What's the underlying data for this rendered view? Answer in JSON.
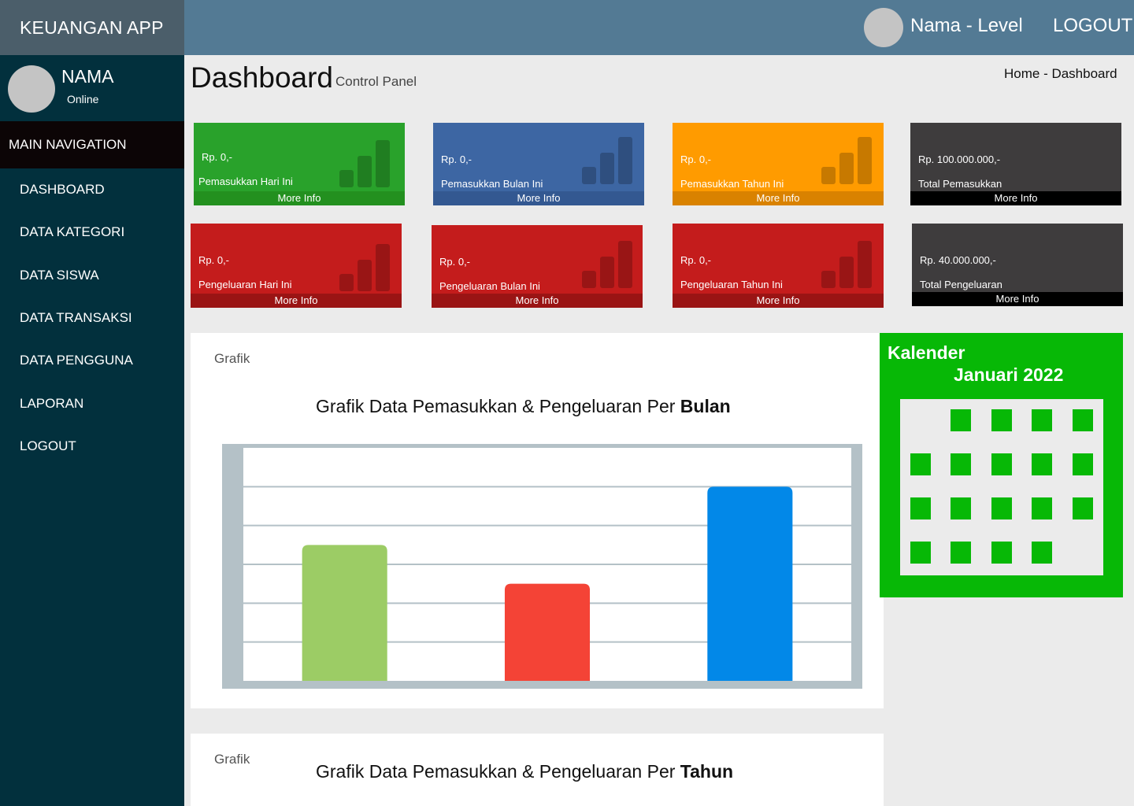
{
  "app": {
    "title": "KEUANGAN APP"
  },
  "topbar": {
    "user": "Nama - Level",
    "logout": "LOGOUT"
  },
  "sidebar": {
    "user_name": "NAMA",
    "status": "Online",
    "section_title": "MAIN NAVIGATION",
    "items": [
      {
        "label": "DASHBOARD"
      },
      {
        "label": "DATA KATEGORI"
      },
      {
        "label": "DATA SISWA"
      },
      {
        "label": "DATA TRANSAKSI"
      },
      {
        "label": "DATA PENGGUNA"
      },
      {
        "label": "LAPORAN"
      },
      {
        "label": "LOGOUT"
      }
    ]
  },
  "header": {
    "title": "Dashboard",
    "subtitle": "Control Panel",
    "breadcrumb": "Home - Dashboard"
  },
  "boxes": [
    {
      "amount": "Rp. 0,-",
      "label": "Pemasukkan Hari Ini",
      "more": "More Info",
      "color": "#29a22b",
      "footer_color": "#23901f"
    },
    {
      "amount": "Rp. 0,-",
      "label": "Pemasukkan Bulan Ini",
      "more": "More Info",
      "color": "#3d66a3",
      "footer_color": "#335891"
    },
    {
      "amount": "Rp. 0,-",
      "label": "Pemasukkan Tahun Ini",
      "more": "More Info",
      "color": "#ff9b00",
      "footer_color": "#d98200"
    },
    {
      "amount": "Rp. 100.000.000,-",
      "label": "Total Pemasukkan",
      "more": "More Info",
      "color": "#3e3c3d",
      "footer_color": "#000000"
    },
    {
      "amount": "Rp. 0,-",
      "label": "Pengeluaran Hari Ini",
      "more": "More Info",
      "color": "#c41c1c",
      "footer_color": "#9a1414"
    },
    {
      "amount": "Rp. 0,-",
      "label": "Pengeluaran Bulan Ini",
      "more": "More Info",
      "color": "#c41c1c",
      "footer_color": "#9a1414"
    },
    {
      "amount": "Rp. 0,-",
      "label": "Pengeluaran Tahun Ini",
      "more": "More Info",
      "color": "#c41c1c",
      "footer_color": "#9a1414"
    },
    {
      "amount": "Rp. 40.000.000,-",
      "label": "Total Pengeluaran",
      "more": "More Info",
      "color": "#3e3c3d",
      "footer_color": "#000000"
    }
  ],
  "grafik_bulan": {
    "label": "Grafik",
    "title_prefix": "Grafik Data Pemasukkan & Pengeluaran Per ",
    "title_bold": "Bulan"
  },
  "grafik_tahun": {
    "label": "Grafik",
    "title_prefix": "Grafik Data Pemasukkan & Pengeluaran Per ",
    "title_bold": "Tahun"
  },
  "chart_data": {
    "type": "bar",
    "categories": [
      "",
      "",
      ""
    ],
    "values": [
      3.5,
      2.5,
      5
    ],
    "colors": [
      "#9ccc65",
      "#f44336",
      "#0288e8"
    ],
    "ylim": [
      0,
      6
    ],
    "grid": true,
    "title": "",
    "xlabel": "",
    "ylabel": ""
  },
  "calendar": {
    "title": "Kalender",
    "month": "Januari 2022",
    "weeks": [
      [
        0,
        1,
        1,
        1,
        1
      ],
      [
        1,
        1,
        1,
        1,
        1
      ],
      [
        1,
        1,
        1,
        1,
        1
      ],
      [
        1,
        1,
        1,
        1,
        0
      ]
    ]
  }
}
